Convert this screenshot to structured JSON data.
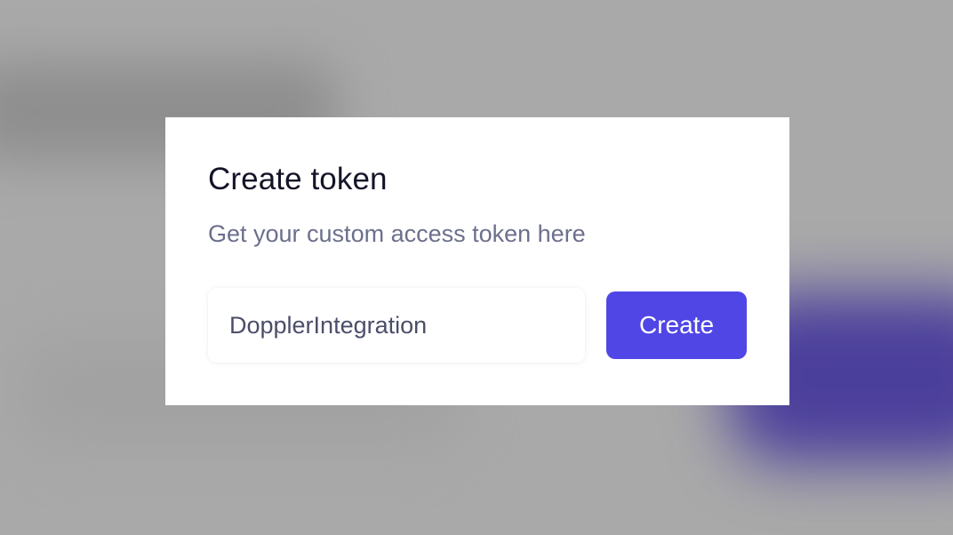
{
  "dialog": {
    "title": "Create token",
    "subtitle": "Get your custom access token here",
    "token_input": {
      "value": "DopplerIntegration",
      "placeholder": ""
    },
    "create_label": "Create"
  },
  "colors": {
    "accent": "#5046e5",
    "backdrop": "#a9a9a9",
    "title_text": "#141428",
    "subtitle_text": "#6c6f8c"
  }
}
